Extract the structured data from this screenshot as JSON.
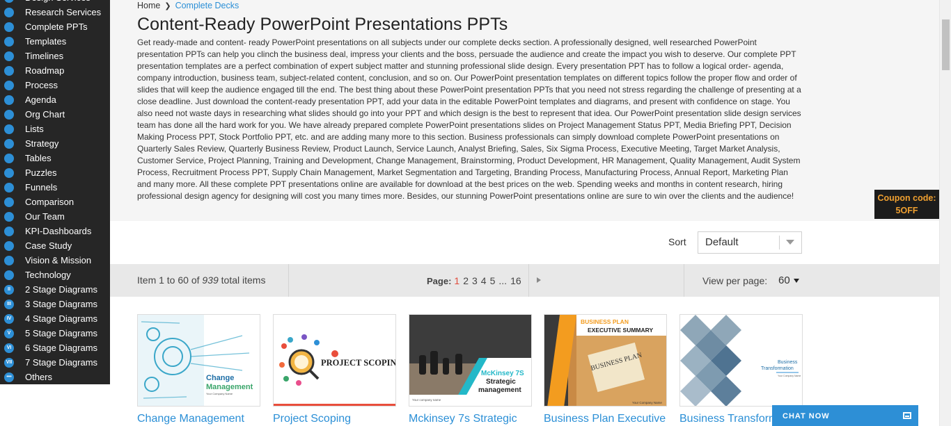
{
  "sidebar": {
    "items": [
      {
        "label": "Design Services",
        "glyph": ""
      },
      {
        "label": "Research Services",
        "glyph": ""
      },
      {
        "label": "Complete PPTs",
        "glyph": ""
      },
      {
        "label": "Templates",
        "glyph": ""
      },
      {
        "label": "Timelines",
        "glyph": ""
      },
      {
        "label": "Roadmap",
        "glyph": ""
      },
      {
        "label": "Process",
        "glyph": ""
      },
      {
        "label": "Agenda",
        "glyph": ""
      },
      {
        "label": "Org Chart",
        "glyph": ""
      },
      {
        "label": "Lists",
        "glyph": ""
      },
      {
        "label": "Strategy",
        "glyph": ""
      },
      {
        "label": "Tables",
        "glyph": ""
      },
      {
        "label": "Puzzles",
        "glyph": ""
      },
      {
        "label": "Funnels",
        "glyph": ""
      },
      {
        "label": "Comparison",
        "glyph": ""
      },
      {
        "label": "Our Team",
        "glyph": ""
      },
      {
        "label": "KPI-Dashboards",
        "glyph": ""
      },
      {
        "label": "Case Study",
        "glyph": ""
      },
      {
        "label": "Vision & Mission",
        "glyph": ""
      },
      {
        "label": "Technology",
        "glyph": ""
      },
      {
        "label": "2 Stage Diagrams",
        "glyph": "II"
      },
      {
        "label": "3 Stage Diagrams",
        "glyph": "III"
      },
      {
        "label": "4 Stage Diagrams",
        "glyph": "IV"
      },
      {
        "label": "5 Stage Diagrams",
        "glyph": "V"
      },
      {
        "label": "6 Stage Diagrams",
        "glyph": "VI"
      },
      {
        "label": "7 Stage Diagrams",
        "glyph": "VII"
      },
      {
        "label": "Others",
        "glyph": "•••"
      }
    ]
  },
  "breadcrumb": {
    "home": "Home",
    "current": "Complete Decks"
  },
  "page": {
    "title": "Content-Ready PowerPoint Presentations PPTs",
    "description": "Get ready-made and content- ready PowerPoint presentations on all subjects under our complete decks section. A professionally designed, well researched PowerPoint presentation PPTs can help you clinch the business deal, impress your clients and the boss, persuade the audience and create the impact you wish to deserve. Our complete PPT presentation templates are a perfect combination of expert subject matter and stunning professional slide design. Every presentation PPT has to follow a logical order- agenda, company introduction, business team, subject-related content, conclusion, and so on. Our PowerPoint presentation templates on different topics follow the proper flow and order of slides that will keep the audience engaged till the end. The best thing about these PowerPoint presentation PPTs that you need not stress regarding the challenge of presenting at a close deadline. Just download the content-ready presentation PPT, add your data in the editable PowerPoint templates and diagrams, and present with confidence on stage. You also need not waste days in researching what slides should go into your PPT and which design is the best to represent that idea. Our PowerPoint presentation slide design services team has done all the hard work for you. We have already prepared complete PowerPoint presentations slides on Project Management Status PPT, Media Briefing PPT, Decision Making Process PPT, Stock Portfolio PPT, etc. and are adding many more to this section. Business professionals can simply download complete PowerPoint presentations on Quarterly Sales Review, Quarterly Business Review, Product Launch, Service Launch, Analyst Briefing, Sales, Six Sigma Process, Executive Meeting, Target Market Analysis, Customer Service, Project Planning, Training and Development, Change Management, Brainstorming, Product Development, HR Management, Quality Management, Audit System Process, Recruitment Process PPT, Supply Chain Management, Market Segmentation and Targeting, Branding Process, Manufacturing Process, Annual Report, Marketing Plan and many more. All these complete PPT presentations online are available for download at the best prices on the web. Spending weeks and months in content research, hiring professional design agency for designing will cost you many times more. Besides, our stunning PowerPoint presentations online are sure to win over the clients and the audience!"
  },
  "coupon": {
    "line1": "Coupon code:",
    "line2": "5OFF"
  },
  "sort": {
    "label": "Sort",
    "value": "Default"
  },
  "pager": {
    "items_prefix": "Item 1 to 60 of",
    "total": "939",
    "items_suffix": "total items",
    "page_label": "Page:",
    "pages": [
      "1",
      "2",
      "3",
      "4",
      "5",
      "...",
      "16"
    ],
    "current_page": "1",
    "view_per_page_label": "View per page:",
    "view_per_page_value": "60"
  },
  "products": [
    {
      "title": "Change Management",
      "thumb_title": "Change Management",
      "thumb_sub": "Your Company Name"
    },
    {
      "title": "Project Scoping",
      "thumb_title": "PROJECT SCOPING",
      "thumb_sub": ""
    },
    {
      "title": "Mckinsey 7s Strategic",
      "thumb_title1": "McKinsey 7S",
      "thumb_title2": "Strategic",
      "thumb_title3": "management",
      "thumb_sub": "Your company name"
    },
    {
      "title": "Business Plan Executive",
      "thumb_title1": "BUSINESS PLAN",
      "thumb_title2": "EXECUTIVE SUMMARY",
      "thumb_sub": "Your Company Name"
    },
    {
      "title": "Business Transform",
      "thumb_title1": "Business",
      "thumb_title2": "Transformation",
      "thumb_sub": "Your Company Name"
    }
  ],
  "chat": {
    "label": "CHAT NOW"
  },
  "colors": {
    "accent": "#2b8fd6",
    "sidebar_bg": "#262626",
    "coupon_text": "#f0a030",
    "active_page": "#e04a3a"
  }
}
